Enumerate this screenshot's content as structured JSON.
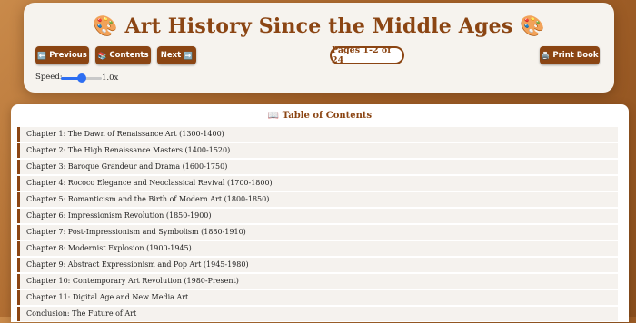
{
  "header": {
    "title": "🎨 Art History Since the Middle Ages 🎨",
    "buttons": {
      "previous": {
        "icon": "⬅️",
        "label": "Previous"
      },
      "contents": {
        "icon": "📚",
        "label": "Contents"
      },
      "next": {
        "icon": "➡️",
        "label": "Next"
      },
      "print": {
        "icon": "🖨️",
        "label": "Print Book"
      }
    },
    "page_indicator": "Pages 1-2 of 24",
    "speed": {
      "label": "Speed:",
      "value": "1.0x",
      "level": 0.5
    }
  },
  "toc": {
    "title": "📖 Table of Contents",
    "items": [
      "Chapter 1: The Dawn of Renaissance Art (1300-1400)",
      "Chapter 2: The High Renaissance Masters (1400-1520)",
      "Chapter 3: Baroque Grandeur and Drama (1600-1750)",
      "Chapter 4: Rococo Elegance and Neoclassical Revival (1700-1800)",
      "Chapter 5: Romanticism and the Birth of Modern Art (1800-1850)",
      "Chapter 6: Impressionism Revolution (1850-1900)",
      "Chapter 7: Post-Impressionism and Symbolism (1880-1910)",
      "Chapter 8: Modernist Explosion (1900-1945)",
      "Chapter 9: Abstract Expressionism and Pop Art (1945-1980)",
      "Chapter 10: Contemporary Art Revolution (1980-Present)",
      "Chapter 11: Digital Age and New Media Art",
      "Conclusion: The Future of Art"
    ]
  },
  "colors": {
    "accent": "#8b4513",
    "slider": "#2d6ef2"
  }
}
